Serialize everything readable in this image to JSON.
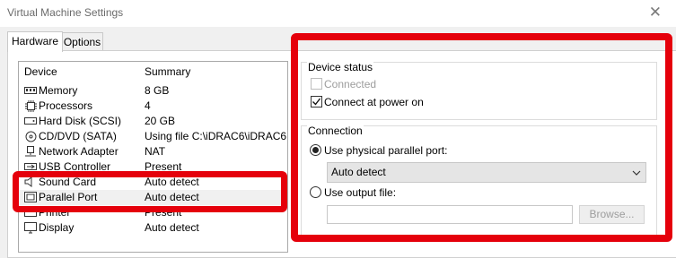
{
  "window": {
    "title": "Virtual Machine Settings",
    "close_glyph": "✕"
  },
  "tabs": [
    {
      "label": "Hardware"
    },
    {
      "label": "Options"
    }
  ],
  "device_list": {
    "headers": {
      "device": "Device",
      "summary": "Summary"
    },
    "rows": [
      {
        "name": "Memory",
        "summary": "8 GB",
        "icon": "memory-icon"
      },
      {
        "name": "Processors",
        "summary": "4",
        "icon": "processor-icon"
      },
      {
        "name": "Hard Disk (SCSI)",
        "summary": "20 GB",
        "icon": "hard-disk-icon"
      },
      {
        "name": "CD/DVD (SATA)",
        "summary": "Using file C:\\iDRAC6\\iDRAC6...",
        "icon": "cd-dvd-icon"
      },
      {
        "name": "Network Adapter",
        "summary": "NAT",
        "icon": "network-adapter-icon"
      },
      {
        "name": "USB Controller",
        "summary": "Present",
        "icon": "usb-controller-icon"
      },
      {
        "name": "Sound Card",
        "summary": "Auto detect",
        "icon": "sound-card-icon"
      },
      {
        "name": "Parallel Port",
        "summary": "Auto detect",
        "icon": "parallel-port-icon",
        "selected": true
      },
      {
        "name": "Printer",
        "summary": "Present",
        "icon": "printer-icon"
      },
      {
        "name": "Display",
        "summary": "Auto detect",
        "icon": "display-icon"
      }
    ]
  },
  "device_status": {
    "title": "Device status",
    "connected": {
      "label": "Connected",
      "checked": false,
      "enabled": false
    },
    "connect_at_power_on": {
      "label": "Connect at power on",
      "checked": true
    }
  },
  "connection": {
    "title": "Connection",
    "use_physical": {
      "label": "Use physical parallel port:",
      "selected": true
    },
    "physical_port_value": "Auto detect",
    "use_output_file": {
      "label": "Use output file:",
      "selected": false
    },
    "output_file_value": "",
    "browse_label": "Browse..."
  },
  "annotation_color": "#e5000b"
}
